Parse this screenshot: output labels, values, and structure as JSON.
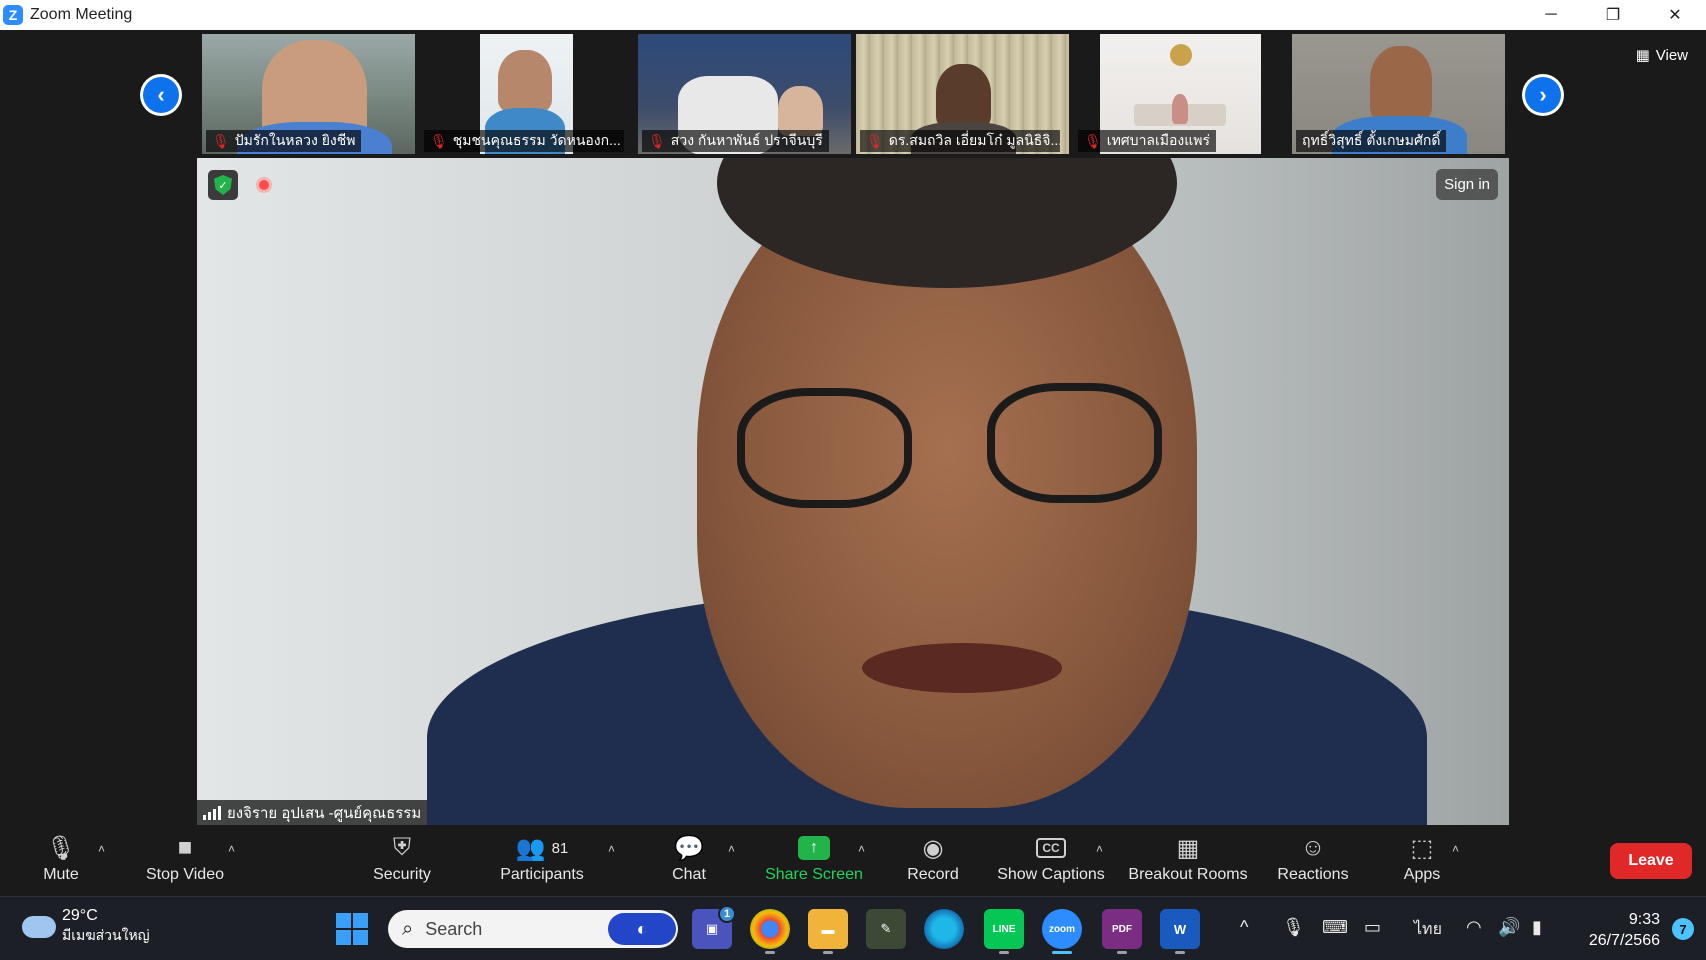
{
  "window": {
    "title": "Zoom Meeting",
    "logo_letter": "Z",
    "controls": {
      "minimize": "─",
      "restore": "❐",
      "close": "✕"
    }
  },
  "gallery": {
    "prev_arrow": "‹",
    "next_arrow": "›",
    "view_label": "View",
    "participants": [
      {
        "name": "ปัมรักในหลวง ยิงชีพ",
        "muted": true
      },
      {
        "name": "ชุมชนคุณธรรม วัดหนองก...",
        "muted": true
      },
      {
        "name": "สวง กันหาพันธ์ ปราจีนบุรี",
        "muted": true
      },
      {
        "name": "ดร.สมถวิล เอี่ยมโก๋ มูลนิธิจิ...",
        "muted": true
      },
      {
        "name": "เทศบาลเมืองแพร่",
        "muted": true
      },
      {
        "name": "ฤทธิ์วิสุทธิ์ ตั้งเกษมศักดิ์",
        "muted": false
      }
    ]
  },
  "main_video": {
    "speaker_name": "ยงจิราย อุปเสน -ศูนย์คุณธรรม",
    "sign_in_label": "Sign in",
    "shield_glyph": "✓"
  },
  "toolbar": {
    "mute_label": "Mute",
    "stop_video_label": "Stop Video",
    "security_label": "Security",
    "participants_label": "Participants",
    "participants_count": "81",
    "chat_label": "Chat",
    "share_screen_label": "Share Screen",
    "record_label": "Record",
    "show_captions_label": "Show Captions",
    "captions_glyph": "CC",
    "breakout_rooms_label": "Breakout Rooms",
    "reactions_label": "Reactions",
    "apps_label": "Apps",
    "leave_label": "Leave",
    "caret": "˄",
    "icons": {
      "mute": "🎙",
      "stop_video": "■",
      "security": "⛨",
      "participants": "👥",
      "chat": "💬",
      "share_screen": "↑",
      "record": "◉",
      "breakout_rooms": "▦",
      "reactions": "☺",
      "apps": "⬚"
    }
  },
  "taskbar": {
    "weather_temp": "29°C",
    "weather_desc": "มีเมฆส่วนใหญ่",
    "search_placeholder": "Search",
    "search_icon": "⌕",
    "teams_badge": "1",
    "zoom_label": "zoom",
    "line_label": "LINE",
    "pdf_label": "PDF",
    "word_label": "W",
    "tray_chevron": "^",
    "tray_mic": "🎙",
    "tray_keyboard": "⌨",
    "tray_tablet": "▭",
    "tray_language": "ไทย",
    "tray_wifi": "◠",
    "tray_volume": "🔊",
    "tray_battery": "▮",
    "time": "9:33",
    "date": "26/7/2566",
    "notification_count": "7"
  },
  "colors": {
    "accent_blue": "#0e72ed",
    "share_green": "#23b34b",
    "leave_red": "#e02828",
    "muted_red": "#e02828",
    "background": "#1a1a1a"
  }
}
